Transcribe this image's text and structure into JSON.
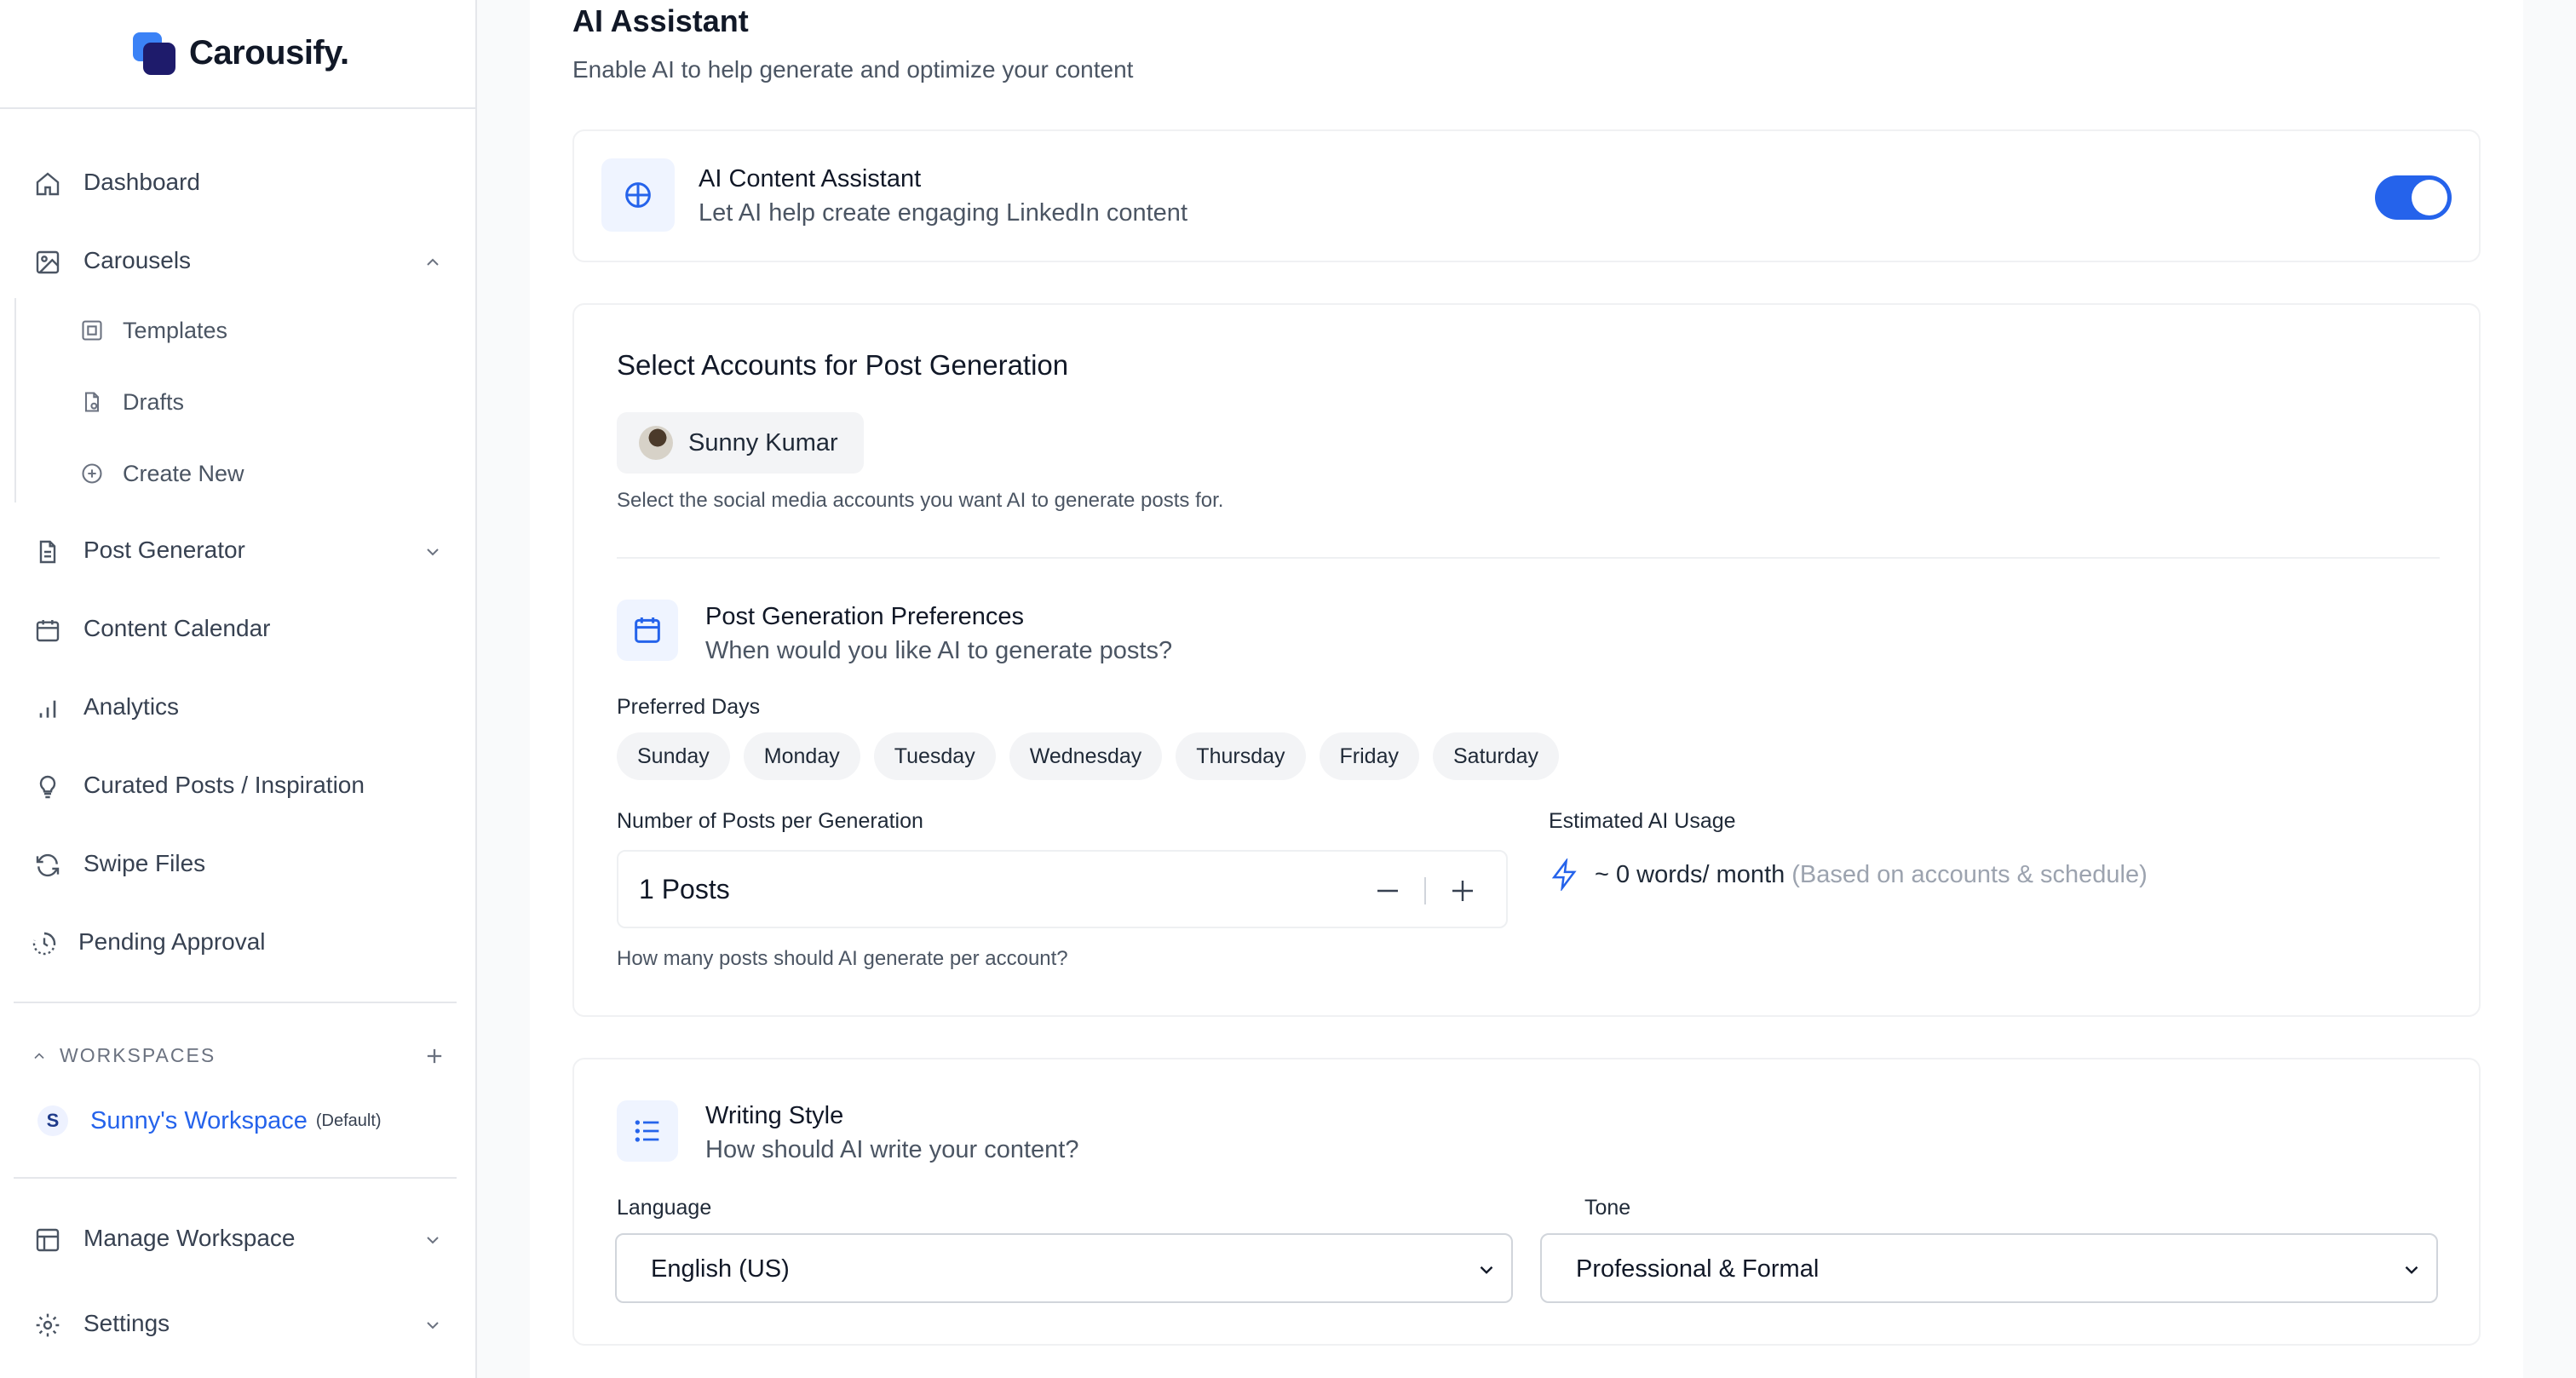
{
  "brand": {
    "name": "Carousify."
  },
  "nav": {
    "dashboard": "Dashboard",
    "carousels": "Carousels",
    "templates": "Templates",
    "drafts": "Drafts",
    "create_new": "Create New",
    "post_generator": "Post Generator",
    "content_calendar": "Content Calendar",
    "analytics": "Analytics",
    "curated": "Curated Posts / Inspiration",
    "swipe_files": "Swipe Files",
    "pending_approval": "Pending Approval",
    "manage_workspace": "Manage Workspace",
    "settings": "Settings"
  },
  "workspaces": {
    "heading": "WORKSPACES",
    "items": [
      {
        "initial": "S",
        "name": "Sunny's Workspace",
        "tag": "(Default)"
      }
    ]
  },
  "page": {
    "title": "AI Assistant",
    "subtitle": "Enable AI to help generate and optimize your content"
  },
  "assistant": {
    "title": "AI Content Assistant",
    "subtitle": "Let AI help create engaging LinkedIn content",
    "enabled": true
  },
  "accounts": {
    "title": "Select Accounts for Post Generation",
    "selected": "Sunny Kumar",
    "hint": "Select the social media accounts you want AI to generate posts for."
  },
  "preferences": {
    "title": "Post Generation Preferences",
    "subtitle": "When would you like AI to generate posts?",
    "days_label": "Preferred Days",
    "days": [
      "Sunday",
      "Monday",
      "Tuesday",
      "Wednesday",
      "Thursday",
      "Friday",
      "Saturday"
    ],
    "posts_label": "Number of Posts per Generation",
    "posts_value": "1 Posts",
    "posts_hint": "How many posts should AI generate per account?",
    "usage_label": "Estimated AI Usage",
    "usage_value": "~ 0 words/ month",
    "usage_note": "(Based on accounts & schedule)"
  },
  "writing": {
    "title": "Writing Style",
    "subtitle": "How should AI write your content?",
    "language_label": "Language",
    "language_value": "English (US)",
    "tone_label": "Tone",
    "tone_value": "Professional & Formal"
  },
  "colors": {
    "accent": "#2563eb",
    "brand_dark": "#1e1b6b",
    "brand_light": "#3b82f6"
  }
}
